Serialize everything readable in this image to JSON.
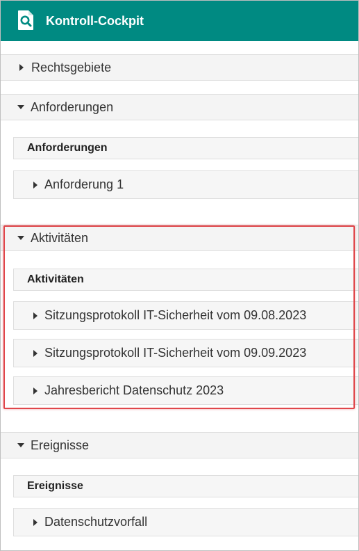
{
  "header": {
    "title": "Kontroll-Cockpit",
    "icon": "document-search-icon",
    "brand_color": "#008a82"
  },
  "sections": [
    {
      "label": "Rechtsgebiete",
      "expanded": false
    },
    {
      "label": "Anforderungen",
      "expanded": true,
      "sub_header": "Anforderungen",
      "items": [
        "Anforderung 1"
      ]
    },
    {
      "label": "Aktivitäten",
      "expanded": true,
      "highlighted": true,
      "highlight_color": "#e0464a",
      "sub_header": "Aktivitäten",
      "items": [
        "Sitzungsprotokoll IT-Sicherheit vom 09.08.2023",
        "Sitzungsprotokoll IT-Sicherheit vom 09.09.2023",
        "Jahresbericht Datenschutz 2023"
      ]
    },
    {
      "label": "Ereignisse",
      "expanded": true,
      "sub_header": "Ereignisse",
      "items": [
        "Datenschutzvorfall"
      ]
    }
  ]
}
